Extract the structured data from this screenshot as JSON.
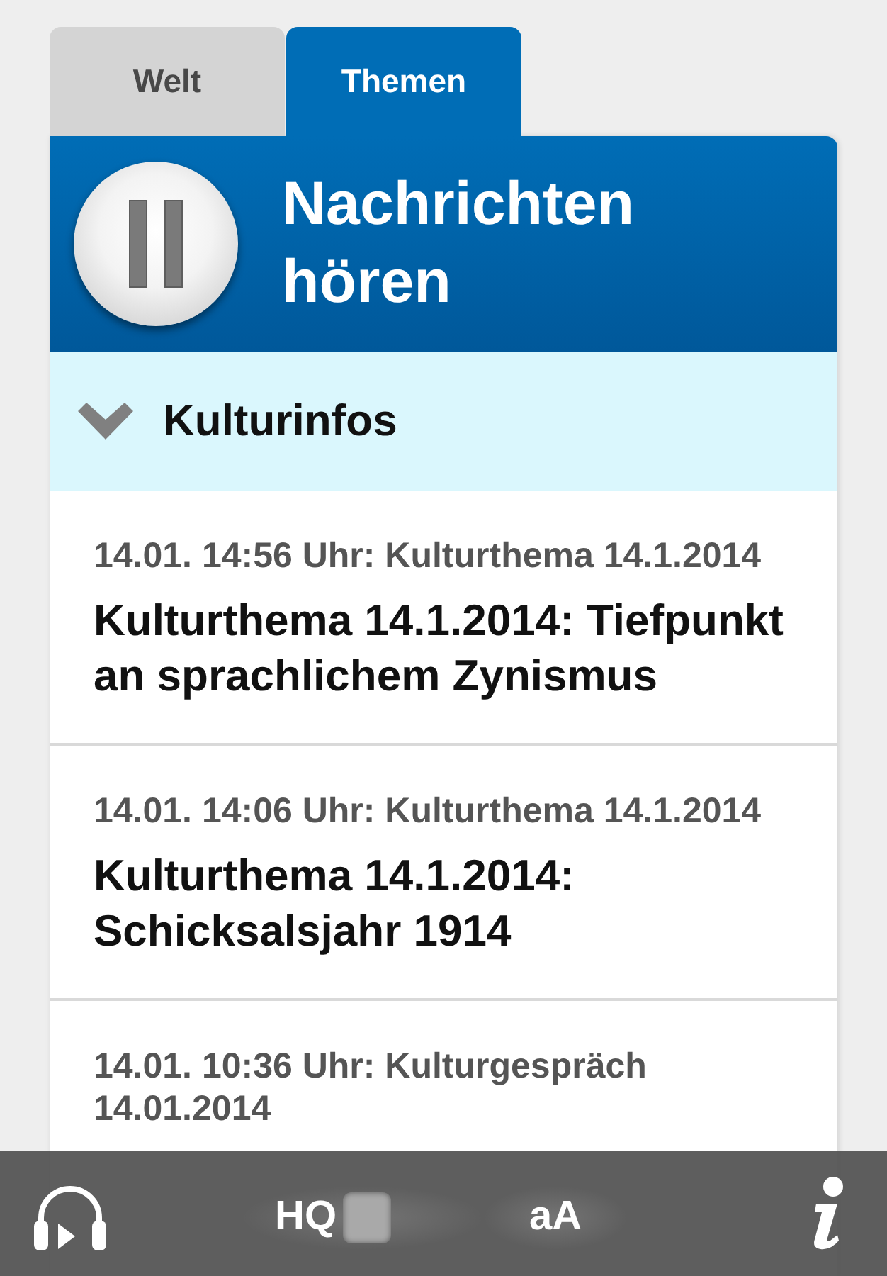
{
  "tabs": [
    {
      "label": "Welt",
      "selected": false
    },
    {
      "label": "Themen",
      "selected": true
    }
  ],
  "player": {
    "title": "Nachrichten hören",
    "playing": true
  },
  "section": {
    "title": "Kulturinfos",
    "expanded": true
  },
  "items": [
    {
      "meta": "14.01. 14:56 Uhr: Kulturthema 14.1.2014",
      "title": "Kulturthema 14.1.2014: Tiefpunkt an sprachlichem Zynismus"
    },
    {
      "meta": "14.01. 14:06 Uhr: Kulturthema 14.1.2014",
      "title": "Kulturthema 14.1.2014: Schicksalsjahr 1914"
    },
    {
      "meta": "14.01. 10:36 Uhr: Kulturgespräch 14.01.2014"
    }
  ],
  "toolbar": {
    "hq": {
      "label": "HQ",
      "on": false
    },
    "text_size": {
      "label": "aA"
    }
  }
}
